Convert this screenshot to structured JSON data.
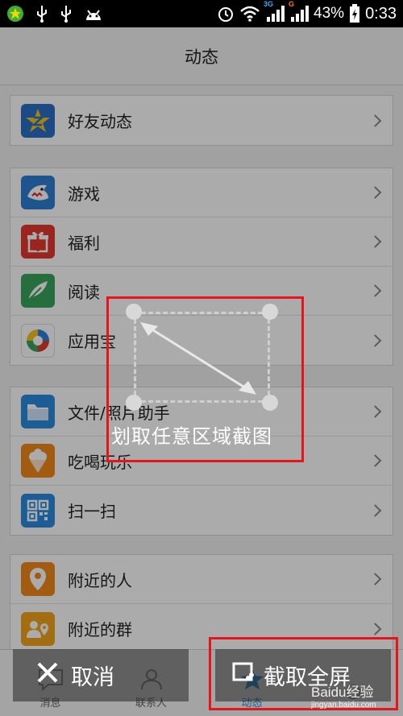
{
  "status_bar": {
    "battery": "43%",
    "time": "0:33",
    "net_3g": "3G",
    "net_g": "G"
  },
  "title": "动态",
  "groups": [
    {
      "items": [
        {
          "label": "好友动态",
          "icon": "star-z-icon"
        }
      ]
    },
    {
      "items": [
        {
          "label": "游戏",
          "icon": "shark-icon"
        },
        {
          "label": "福利",
          "icon": "gift-icon"
        },
        {
          "label": "阅读",
          "icon": "feather-icon"
        },
        {
          "label": "应用宝",
          "icon": "app-store-icon"
        }
      ]
    },
    {
      "items": [
        {
          "label": "文件/照片助手",
          "icon": "folder-icon"
        },
        {
          "label": "吃喝玩乐",
          "icon": "ice-cream-icon"
        },
        {
          "label": "扫一扫",
          "icon": "qr-code-icon"
        }
      ]
    },
    {
      "items": [
        {
          "label": "附近的人",
          "icon": "location-pin-icon"
        },
        {
          "label": "附近的群",
          "icon": "nearby-group-icon"
        }
      ]
    }
  ],
  "tabs": [
    {
      "label": "消息",
      "icon": "chat-icon"
    },
    {
      "label": "联系人",
      "icon": "contacts-icon"
    },
    {
      "label": "动态",
      "icon": "star-icon",
      "active": true
    },
    {
      "label": "",
      "icon": "profile-icon"
    }
  ],
  "overlay": {
    "hint": "划取任意区域截图",
    "cancel_label": "取消",
    "fullscreen_label": "截取全屏"
  },
  "watermark": {
    "brand": "Baidu经验",
    "url": "jingyan.baidu.com"
  }
}
